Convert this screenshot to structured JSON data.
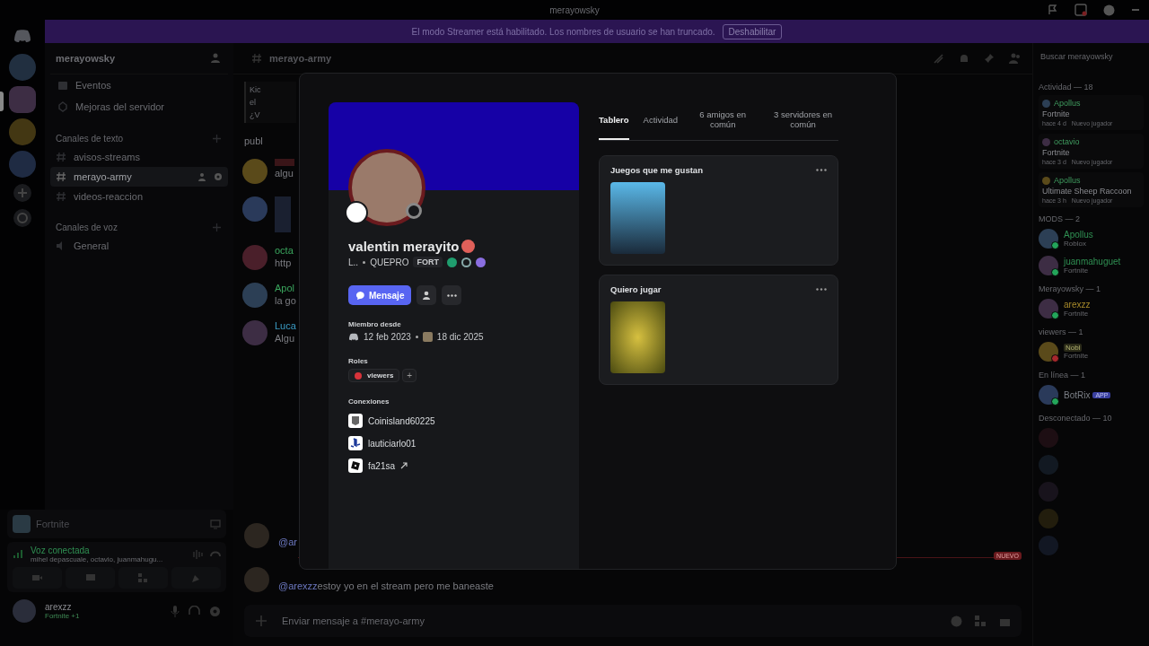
{
  "window": {
    "title": "merayowsky"
  },
  "streamer_banner": {
    "text": "El modo Streamer está habilitado. Los nombres de usuario se han truncado.",
    "button": "Deshabilitar"
  },
  "servers": [
    {
      "selected": false
    },
    {
      "selected": true
    },
    {
      "selected": false
    },
    {
      "selected": false
    }
  ],
  "sidebar": {
    "server_name": "merayowsky",
    "items": [
      {
        "label": "Eventos",
        "kind": "events"
      },
      {
        "label": "Mejoras del servidor",
        "kind": "boost"
      }
    ],
    "categories": [
      {
        "label": "Canales de texto",
        "channels": [
          {
            "name": "avisos-streams",
            "kind": "text",
            "selected": false
          },
          {
            "name": "merayo-army",
            "kind": "text",
            "selected": true
          },
          {
            "name": "videos-reaccion",
            "kind": "text",
            "selected": false
          }
        ]
      },
      {
        "label": "Canales de voz",
        "channels": [
          {
            "name": "General",
            "kind": "voice",
            "selected": false
          }
        ]
      }
    ]
  },
  "activity_panel": {
    "game": "Fortnite"
  },
  "voice_panel": {
    "status": "Voz conectada",
    "members": "mihel depascuale, octavio, juanmahugu..."
  },
  "user_panel": {
    "name": "arexzz",
    "activity": "Fortnite +1"
  },
  "chat": {
    "channel": "merayo-army",
    "messages": [
      {
        "kind": "embed",
        "lines": [
          "Kic",
          "el",
          "¿V"
        ]
      },
      {
        "kind": "text",
        "text": "publ"
      },
      {
        "kind": "message",
        "text": "algu"
      },
      {
        "kind": "image"
      },
      {
        "kind": "message",
        "author": "octa",
        "color": "#3aa55d",
        "text": "http"
      },
      {
        "kind": "message",
        "author": "Apol",
        "color": "#3aa55d",
        "text": "la go"
      },
      {
        "kind": "message",
        "author": "Luca",
        "color": "#3a9bc4",
        "text": "Algu"
      }
    ],
    "recent": [
      {
        "mention": "@ar"
      },
      {
        "mention": "@arexzz",
        "text": "estoy yo en el stream pero me baneaste"
      }
    ],
    "new_marker": "NUEVO",
    "input_placeholder": "Enviar mensaje a #merayo-army"
  },
  "members": {
    "search_placeholder": "Buscar merayowsky",
    "activity_header": "Actividad — 18",
    "activities": [
      {
        "user": "Apollus",
        "game": "Fortnite",
        "time": "hace 4 d",
        "note": "Nuevo jugador"
      },
      {
        "user": "octavio",
        "game": "Fortnite",
        "time": "hace 3 d",
        "note": "Nuevo jugador"
      },
      {
        "user": "Apollus",
        "game": "Ultimate Sheep Raccoon",
        "time": "hace 3 h",
        "note": "Nuevo jugador"
      }
    ],
    "groups": [
      {
        "header": "MODS — 2",
        "members": [
          {
            "name": "Apollus",
            "activity": "Roblox",
            "color": "#2f8f52",
            "online": true,
            "busy": false
          },
          {
            "name": "juanmahuguet",
            "activity": "Fortnite",
            "color": "#2f8f52",
            "online": true,
            "busy": false
          }
        ]
      },
      {
        "header": "Merayowsky — 1",
        "members": [
          {
            "name": "arexzz",
            "activity": "Fortnite",
            "color": "#a88a2a",
            "online": true,
            "busy": false
          }
        ]
      },
      {
        "header": "viewers — 1",
        "members": [
          {
            "tag": "Nobl",
            "activity": "Fortnite",
            "online": true,
            "busy": true
          }
        ]
      },
      {
        "header": "En línea — 1",
        "members": [
          {
            "name": "BotRix",
            "badge": "APP",
            "color": "#7b7f86",
            "online": true,
            "busy": false
          }
        ]
      },
      {
        "header": "Desconectado — 10",
        "members": [
          {
            "online": false
          },
          {
            "online": false
          },
          {
            "online": false
          },
          {
            "online": false
          },
          {
            "online": false
          }
        ]
      }
    ]
  },
  "profile": {
    "display_name": "valentin merayito",
    "username": "L..",
    "pronouns": "QUEPRO",
    "guild_tag": "FORT",
    "message_button": "Mensaje",
    "member_since_label": "Miembro desde",
    "discord_date": "12 feb 2023",
    "server_date": "18 dic 2025",
    "roles_label": "Roles",
    "roles": [
      {
        "name": "viewers",
        "color": "#d8333a"
      }
    ],
    "add_role": "+",
    "connections_label": "Conexiones",
    "connections": [
      {
        "name": "Coinisland60225",
        "kind": "epic",
        "external": false
      },
      {
        "name": "lauticiarlo01",
        "kind": "playstation",
        "external": false
      },
      {
        "name": "fa21sa",
        "kind": "roblox",
        "external": true
      }
    ],
    "tabs": [
      {
        "label": "Tablero",
        "selected": true
      },
      {
        "label": "Actividad",
        "selected": false
      },
      {
        "label": "6 amigos en común",
        "selected": false
      },
      {
        "label": "3 servidores en común",
        "selected": false
      }
    ],
    "boards": [
      {
        "title": "Juegos que me gustan",
        "kind": "liked"
      },
      {
        "title": "Quiero jugar",
        "kind": "wishlist"
      }
    ]
  }
}
